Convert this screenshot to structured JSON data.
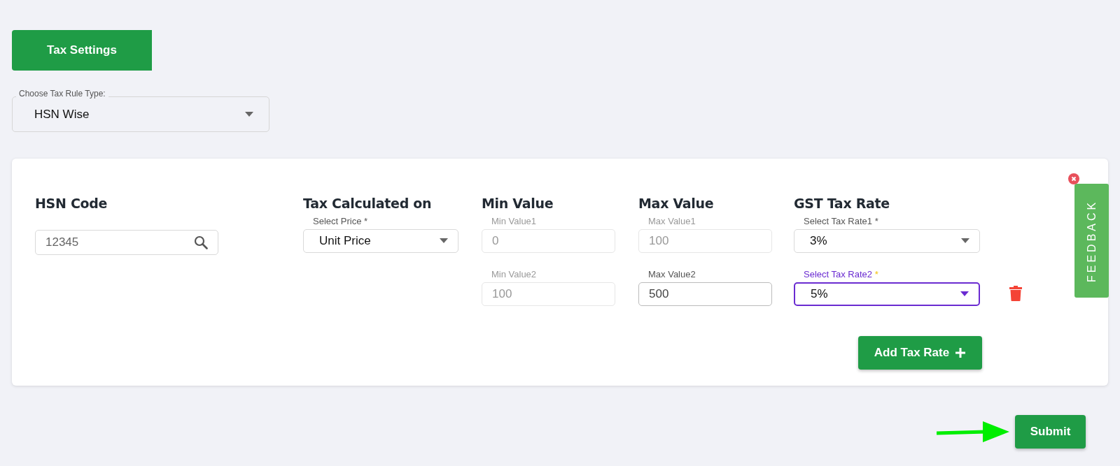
{
  "tab": {
    "label": "Tax Settings"
  },
  "rule_type": {
    "label": "Choose Tax Rule Type:",
    "value": "HSN Wise"
  },
  "columns": [
    "HSN Code",
    "Tax Calculated on",
    "Min Value",
    "Max Value",
    "GST Tax Rate"
  ],
  "hsn_code": {
    "value": "12345"
  },
  "price_select": {
    "label": "Select Price",
    "mark": "*",
    "value": "Unit Price"
  },
  "rates": [
    {
      "min": {
        "label": "Min Value1",
        "value": "0",
        "disabled": true
      },
      "max": {
        "label": "Max Value1",
        "value": "100",
        "disabled": true
      },
      "rate": {
        "label": "Select Tax Rate1",
        "mark": "*",
        "value": "3%",
        "focused": false
      },
      "deletable": false
    },
    {
      "min": {
        "label": "Min Value2",
        "value": "100",
        "disabled": true
      },
      "max": {
        "label": "Max Value2",
        "value": "500",
        "disabled": false
      },
      "rate": {
        "label": "Select Tax Rate2",
        "mark": "*",
        "value": "5%",
        "focused": true
      },
      "deletable": true
    }
  ],
  "add_button": {
    "label": "Add Tax Rate"
  },
  "submit_button": {
    "label": "Submit"
  },
  "feedback": {
    "label": "FEEDBACK"
  }
}
